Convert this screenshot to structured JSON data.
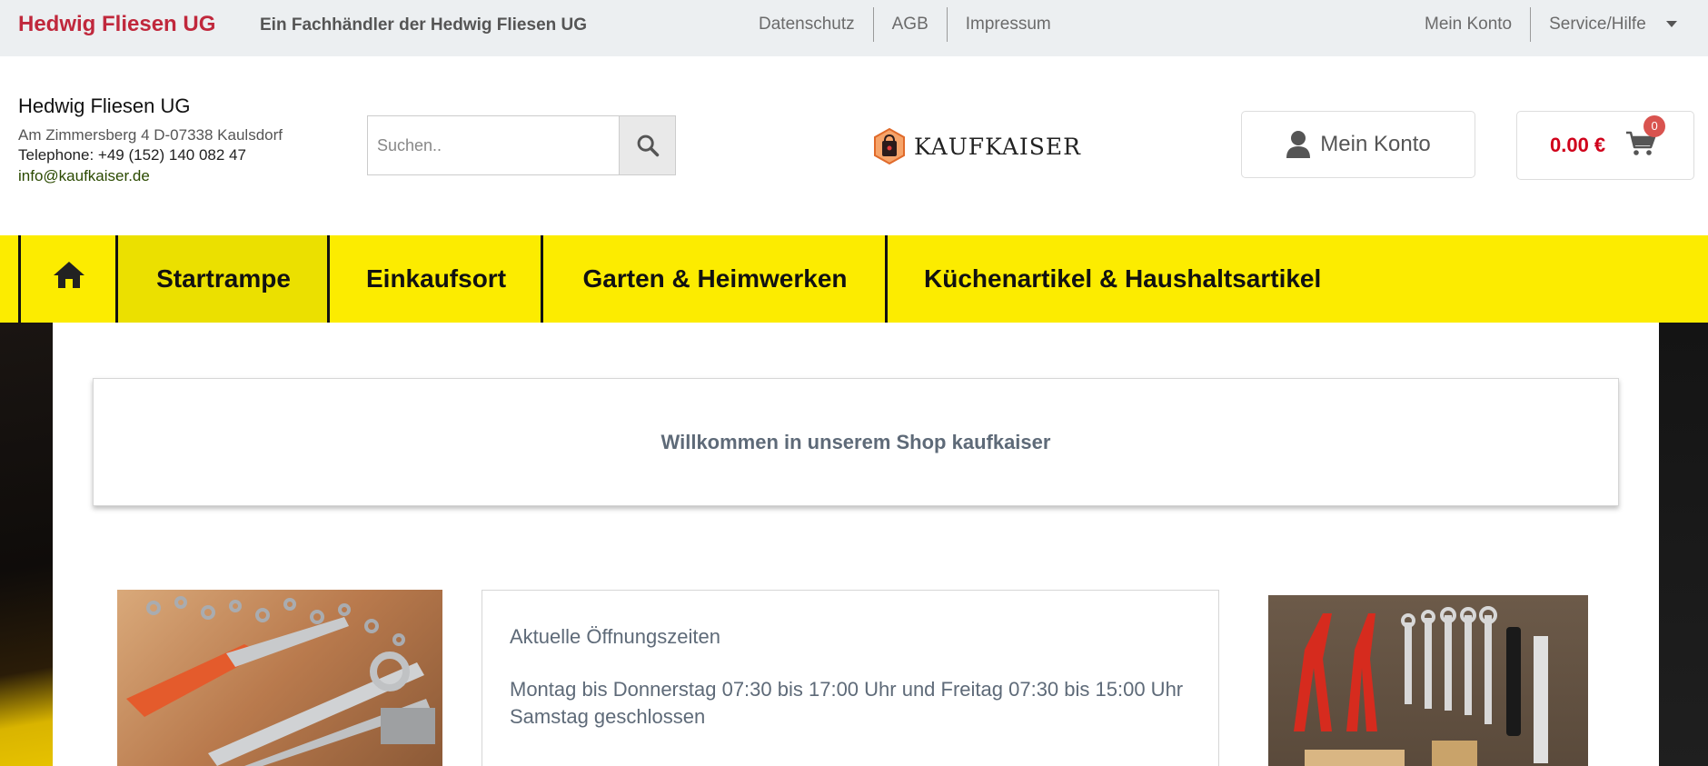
{
  "topbar": {
    "brand": "Hedwig Fliesen UG",
    "tagline": "Ein Fachhändler der Hedwig Fliesen UG",
    "links": [
      "Datenschutz",
      "AGB",
      "Impressum"
    ],
    "account": "Mein Konto",
    "service": "Service/Hilfe"
  },
  "header": {
    "company_name": "Hedwig Fliesen UG",
    "address": "Am Zimmersberg 4 D-07338 Kaulsdorf",
    "phone": "Telephone: +49 (152) 140 082 47",
    "email": "info@kaufkaiser.de",
    "search_placeholder": "Suchen..",
    "logo_text": "KAUFKAISER",
    "account_label": "Mein Konto",
    "cart_amount": "0.00 €",
    "cart_count": "0"
  },
  "nav": {
    "items": [
      "Startrampe",
      "Einkaufsort",
      "Garten & Heimwerken",
      "Küchenartikel & Haushaltsartikel"
    ]
  },
  "main": {
    "welcome": "Willkommen in unserem Shop kaufkaiser",
    "hours_title": "Aktuelle Öffnungszeiten",
    "hours_line1": "Montag bis Donnerstag 07:30 bis 17:00 Uhr und Freitag 07:30 bis 15:00 Uhr",
    "hours_line2": "Samstag geschlossen"
  },
  "icons": {
    "search": "search-icon",
    "user": "user-icon",
    "cart": "cart-icon",
    "home": "home-icon"
  },
  "colors": {
    "brand": "#c0283c",
    "nav_bg": "#fcec00",
    "price": "#d0021b"
  }
}
